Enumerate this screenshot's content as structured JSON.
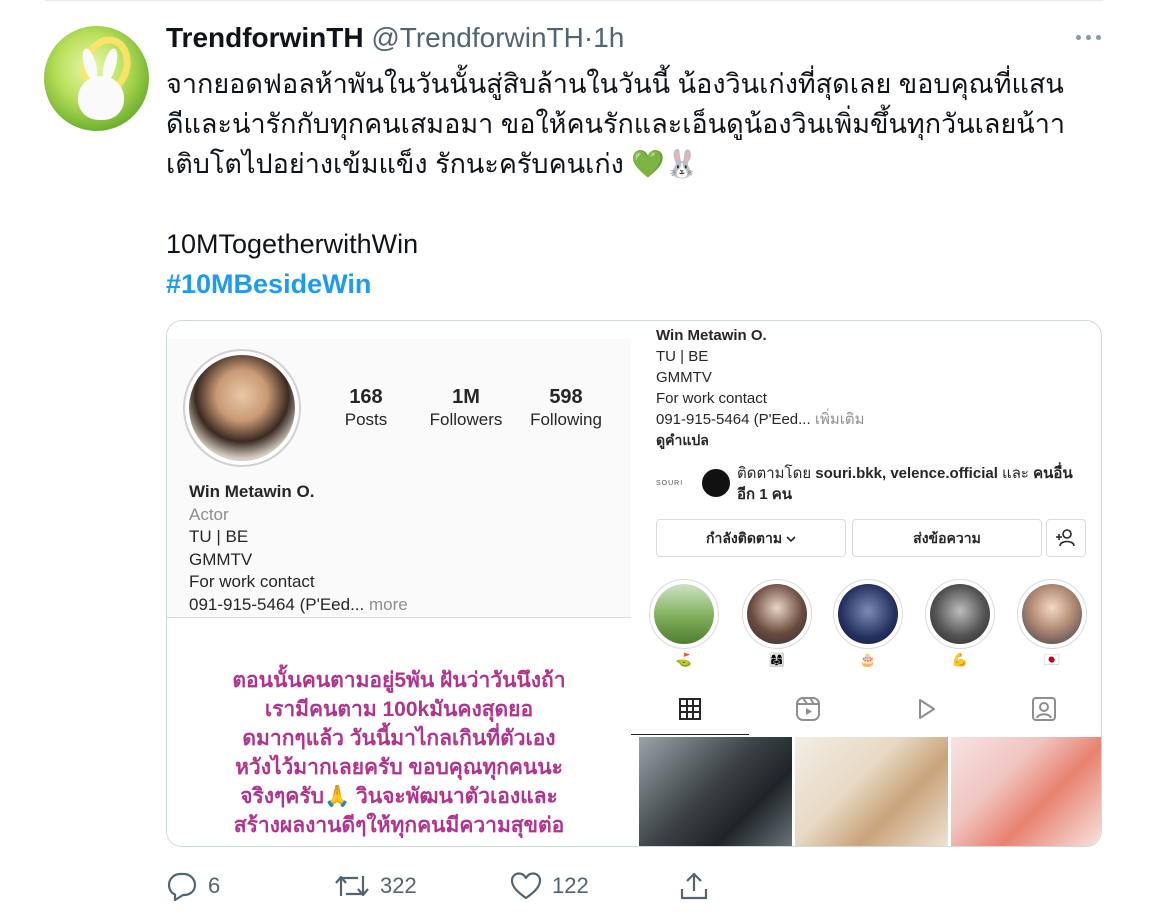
{
  "tweet": {
    "author_name": "TrendforwinTH",
    "author_handle": "@TrendforwinTH",
    "separator": "·",
    "time": "1h",
    "text_lines": [
      "จากยอดฟอลห้าพันในวันนั้นสู่สิบล้านในวันนี้ น้องวินเก่งที่สุดเลย ขอบคุณที่แสน",
      "ดีและน่ารักกับทุกคนเสมอมา ขอให้คนรักและเอ็นดูน้องวินเพิ่มขึ้นทุกวันเลยน้าา",
      "เติบโตไปอย่างเข้มแข็ง รักนะครับคนเก่ง"
    ],
    "emojis": "💚🐰",
    "tag_plain": "10MTogetherwithWin",
    "tag_link": "#10MBesideWin"
  },
  "actions": {
    "replies": "6",
    "retweets": "322",
    "likes": "122"
  },
  "ig_left": {
    "stats": [
      {
        "num": "168",
        "label": "Posts"
      },
      {
        "num": "1M",
        "label": "Followers"
      },
      {
        "num": "598",
        "label": "Following"
      }
    ],
    "bio_name": "Win Metawin O.",
    "bio_role": "Actor",
    "bio_lines": [
      "TU | BE",
      "GMMTV",
      "For work contact"
    ],
    "bio_phone": "091-915-5464 (P'Eed... ",
    "bio_more": "more",
    "note_lines": [
      "ตอนนั้นคนตามอยู่5พัน  ฝันว่าวันนึงถ้า",
      "เรามีคนตาม  100kมันคงสุดยอ",
      "ดมากๆแล้ว  วันนี้มาไกลเกินที่ตัวเอง",
      "หวังไว้มากเลยครับ  ขอบคุณทุกคนนะ",
      "จริงๆครับ🙏  วินจะพัฒนาตัวเองและ",
      "สร้างผลงานดีๆให้ทุกคนมีความสุขต่อ"
    ]
  },
  "ig_right": {
    "name": "Win Metawin O.",
    "lines": [
      "TU | BE",
      "GMMTV",
      "For work contact"
    ],
    "phone": "091-915-5464 (P'Eed... ",
    "more_th": "เพิ่มเติม",
    "translate": "ดูคำแปล",
    "followed_prefix": "ติดตามโดย ",
    "followed_names": "souri.bkk, velence.official",
    "followed_and": " และ ",
    "followed_others": "คนอื่น",
    "followed_rest": "อีก 1 คน",
    "follower_brand": "SOURI",
    "btn_following": "กำลังติดตาม",
    "btn_message": "ส่งข้อความ",
    "highlights": [
      "⛳",
      "👩‍👩‍👧",
      "🎂",
      "💪",
      "🇯🇵"
    ]
  },
  "colors": {
    "link": "#1d9bf0",
    "note_text": "#b0338d",
    "muted": "#536471"
  }
}
